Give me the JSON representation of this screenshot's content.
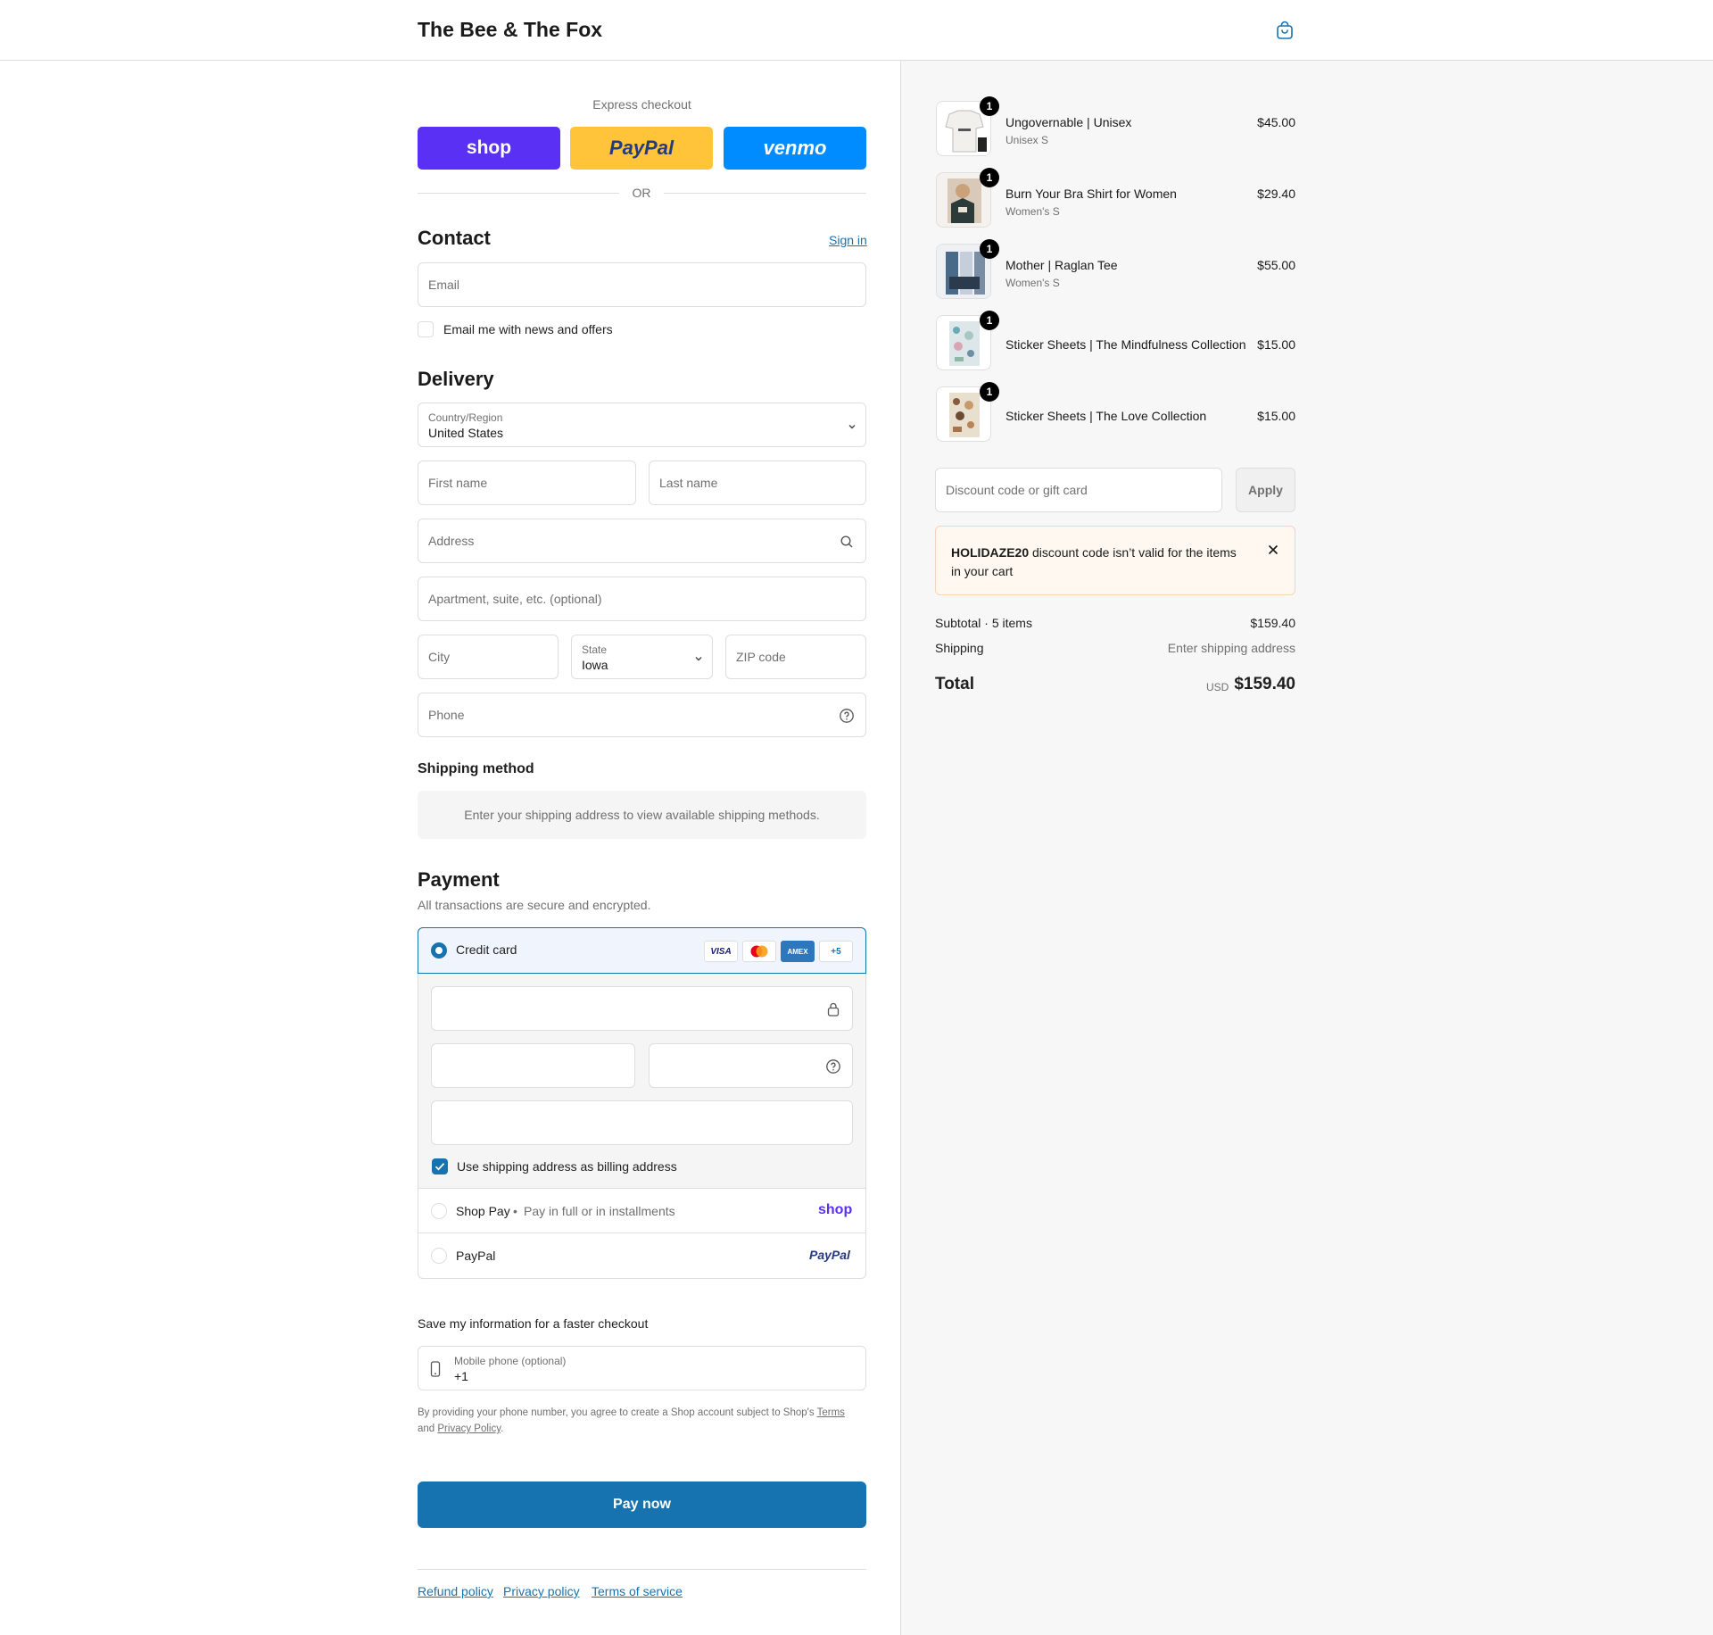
{
  "header": {
    "brand": "The Bee & The Fox"
  },
  "express": {
    "label": "Express checkout",
    "shop": "shop",
    "paypal": "PayPal",
    "venmo": "venmo",
    "or": "OR"
  },
  "contact": {
    "title": "Contact",
    "sign_in": "Sign in",
    "email_placeholder": "Email",
    "news_label": "Email me with news and offers"
  },
  "delivery": {
    "title": "Delivery",
    "country_label": "Country/Region",
    "country_value": "United States",
    "first_name": "First name",
    "last_name": "Last name",
    "address": "Address",
    "apartment": "Apartment, suite, etc. (optional)",
    "city": "City",
    "state_label": "State",
    "state_value": "Iowa",
    "zip": "ZIP code",
    "phone": "Phone"
  },
  "shipping_method": {
    "title": "Shipping method",
    "notice": "Enter your shipping address to view available shipping methods."
  },
  "payment": {
    "title": "Payment",
    "subtitle": "All transactions are secure and encrypted.",
    "credit_card": "Credit card",
    "logos": {
      "visa": "VISA",
      "amex": "AMEX",
      "more": "+5"
    },
    "billing_checkbox": "Use shipping address as billing address",
    "shop_pay": "Shop Pay",
    "shop_pay_sub": "Pay in full or in installments",
    "shop_logo": "shop",
    "paypal": "PayPal",
    "paypal_logo": "PayPal"
  },
  "save_info": {
    "title": "Save my information for a faster checkout",
    "mobile_label": "Mobile phone (optional)",
    "mobile_value": "+1",
    "disclaimer_start": "By providing your phone number, you agree to create a Shop account subject to Shop's",
    "terms": "Terms",
    "and": "and",
    "privacy": "Privacy Policy",
    "period": "."
  },
  "pay_button": "Pay now",
  "footer": {
    "refund": "Refund policy",
    "privacy": "Privacy policy",
    "terms": "Terms of service"
  },
  "cart": {
    "items": [
      {
        "name": "Ungovernable | Unisex",
        "variant": "Unisex S",
        "price": "$45.00",
        "qty": "1"
      },
      {
        "name": "Burn Your Bra Shirt for Women",
        "variant": "Women's S",
        "price": "$29.40",
        "qty": "1"
      },
      {
        "name": "Mother | Raglan Tee",
        "variant": "Women's S",
        "price": "$55.00",
        "qty": "1"
      },
      {
        "name": "Sticker Sheets | The Mindfulness Collection",
        "variant": "",
        "price": "$15.00",
        "qty": "1"
      },
      {
        "name": "Sticker Sheets | The Love Collection",
        "variant": "",
        "price": "$15.00",
        "qty": "1"
      }
    ],
    "discount_placeholder": "Discount code or gift card",
    "apply": "Apply",
    "error_code": "HOLIDAZE20",
    "error_msg_1": "discount code isn’t valid for the items",
    "error_msg_2": "in your cart",
    "subtotal_label": "Subtotal · 5 items",
    "subtotal_value": "$159.40",
    "shipping_label": "Shipping",
    "shipping_value": "Enter shipping address",
    "total_label": "Total",
    "currency": "USD",
    "total_value": "$159.40"
  },
  "colors": {
    "accent": "#1773b0",
    "shop_purple": "#5a31f4",
    "paypal_yellow": "#ffc439",
    "venmo_blue": "#008cff",
    "error_bg": "#fff8f0"
  }
}
